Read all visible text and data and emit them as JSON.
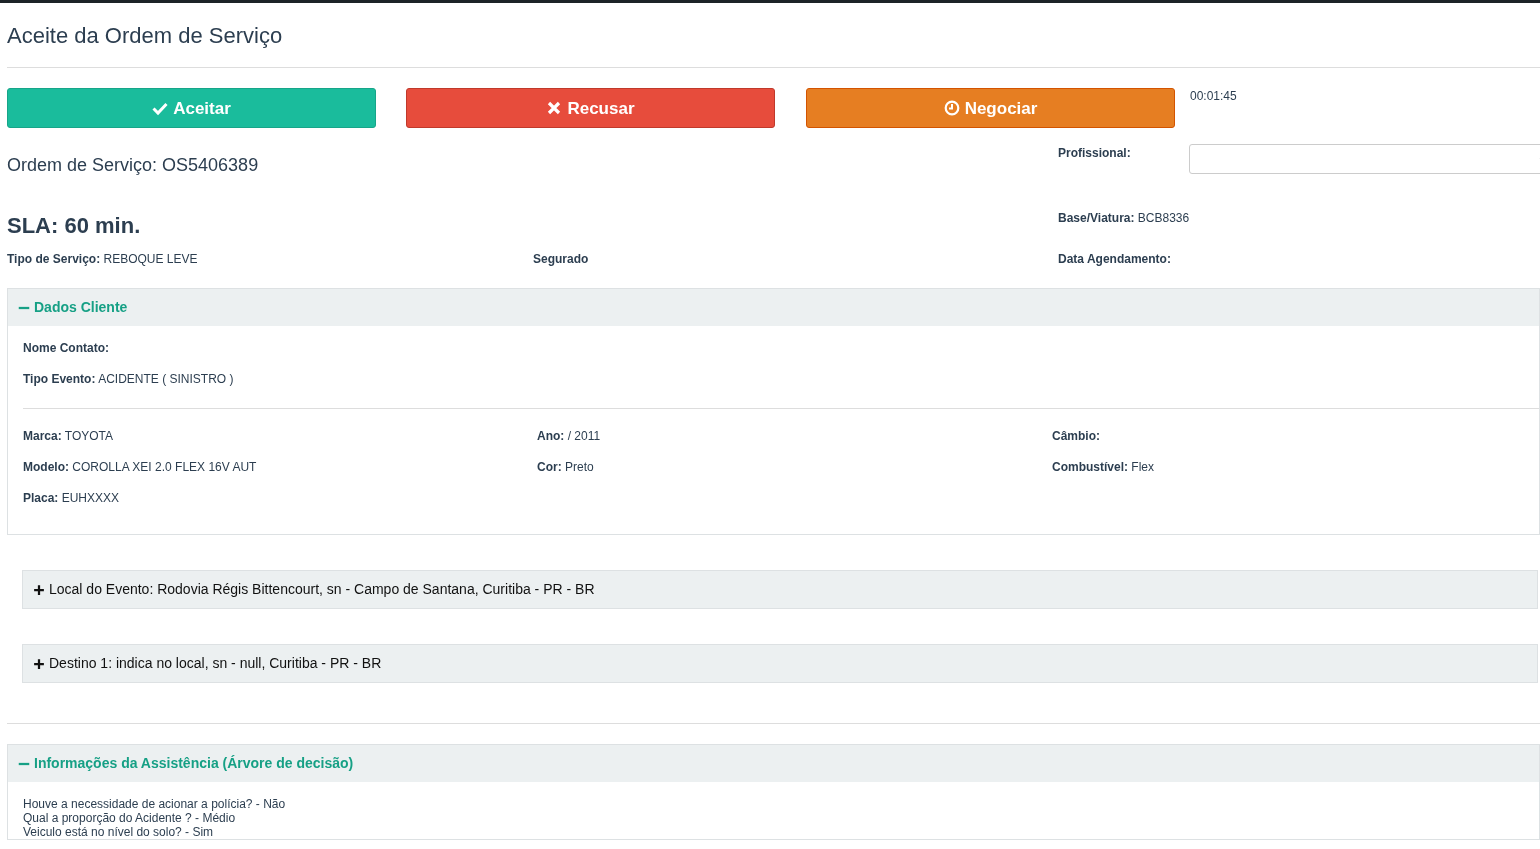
{
  "title": "Aceite da Ordem de Serviço",
  "actions": [
    {
      "kind": "accept",
      "label": "Aceitar"
    },
    {
      "kind": "refuse",
      "label": "Recusar"
    },
    {
      "kind": "negotiate",
      "label": "Negociar"
    }
  ],
  "timer": "00:01:45",
  "order": "Ordem de Serviço: OS5406389",
  "profissional": {
    "label": "Profissional:"
  },
  "sla": "SLA: 60 min.",
  "base_viatura": {
    "label": "Base/Viatura:",
    "value": "BCB8336"
  },
  "summary_fields": [
    {
      "label": "Tipo de Serviço:",
      "value": "REBOQUE LEVE"
    },
    {
      "label": "Segurado"
    },
    {
      "label": "Data Agendamento:"
    }
  ],
  "client_panel": {
    "title": "Dados Cliente",
    "expanded": true,
    "contact_fields": [
      {
        "label": "Nome Contato:"
      },
      {
        "label": "Tipo Evento:",
        "value": "ACIDENTE ( SINISTRO )"
      }
    ],
    "vehicle_columns": [
      [
        {
          "label": "Marca:",
          "value": "TOYOTA"
        },
        {
          "label": "Modelo:",
          "value": "COROLLA XEI 2.0 FLEX 16V AUT"
        },
        {
          "label": "Placa:",
          "value": "EUHXXXX"
        }
      ],
      [
        {
          "label": "Ano:",
          "value": "/ 2011"
        },
        {
          "label": "Cor:",
          "value": "Preto"
        }
      ],
      [
        {
          "label": "Câmbio:"
        },
        {
          "label": "Combustível:",
          "value": "Flex"
        }
      ]
    ]
  },
  "address_panels": [
    {
      "title": "Local do Evento: Rodovia Régis Bittencourt, sn - Campo de Santana, Curitiba - PR - BR",
      "expanded": false
    },
    {
      "title": "Destino 1: indica no local, sn - null, Curitiba - PR - BR",
      "expanded": false
    }
  ],
  "assistance_panel": {
    "title": "Informações da Assistência (Árvore de decisão)",
    "expanded": true,
    "lines": [
      "Houve a necessidade de acionar a polícia? - Não",
      "Qual a proporção do Acidente ? - Médio",
      "Veiculo está no nível do solo? - Sim"
    ]
  }
}
